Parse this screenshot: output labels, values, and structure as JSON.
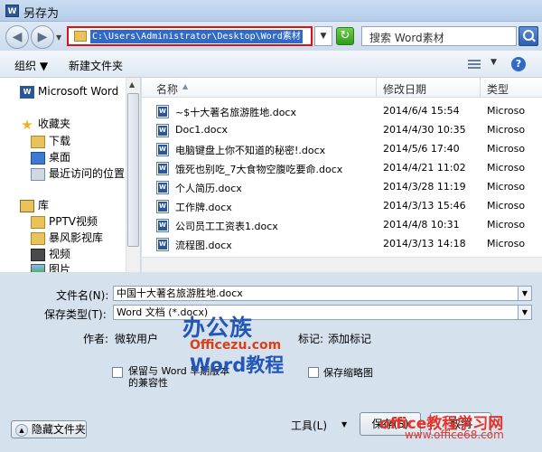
{
  "window": {
    "title": "另存为",
    "app_icon": "word-app-icon"
  },
  "nav": {
    "address": "C:\\Users\\Administrator\\Desktop\\Word素材",
    "search_placeholder": "搜索 Word素材"
  },
  "toolbar": {
    "organize": "组织 ▼",
    "new_folder": "新建文件夹",
    "help": "?"
  },
  "sidebar": {
    "items": [
      {
        "label": "Microsoft Word",
        "icon": "word-icon"
      },
      {
        "label": "收藏夹",
        "icon": "star-icon"
      },
      {
        "label": "下载",
        "icon": "folder-icon"
      },
      {
        "label": "桌面",
        "icon": "desktop-icon"
      },
      {
        "label": "最近访问的位置",
        "icon": "recent-icon"
      },
      {
        "label": "库",
        "icon": "library-icon"
      },
      {
        "label": "PPTV视频",
        "icon": "folder-icon"
      },
      {
        "label": "暴风影视库",
        "icon": "folder-icon"
      },
      {
        "label": "视频",
        "icon": "video-icon"
      },
      {
        "label": "图片",
        "icon": "picture-icon"
      }
    ]
  },
  "filelist": {
    "headers": {
      "name": "名称",
      "date": "修改日期",
      "type": "类型"
    },
    "files": [
      {
        "name": "~$十大著名旅游胜地.docx",
        "date": "2014/6/4 15:54",
        "type": "Microso"
      },
      {
        "name": "Doc1.docx",
        "date": "2014/4/30 10:35",
        "type": "Microso"
      },
      {
        "name": "电脑键盘上你不知道的秘密!.docx",
        "date": "2014/5/6 17:40",
        "type": "Microso"
      },
      {
        "name": "饿死也别吃_7大食物空腹吃要命.docx",
        "date": "2014/4/21 11:02",
        "type": "Microso"
      },
      {
        "name": "个人简历.docx",
        "date": "2014/3/28 11:19",
        "type": "Microso"
      },
      {
        "name": "工作牌.docx",
        "date": "2014/3/13 15:46",
        "type": "Microso"
      },
      {
        "name": "公司员工工资表1.docx",
        "date": "2014/4/8 10:31",
        "type": "Microso"
      },
      {
        "name": "流程图.docx",
        "date": "2014/3/13 14:18",
        "type": "Microso"
      }
    ]
  },
  "form": {
    "filename_label": "文件名(N):",
    "filename_value": "中国十大著名旅游胜地.docx",
    "filetype_label": "保存类型(T):",
    "filetype_value": "Word 文档 (*.docx)",
    "author_label": "作者:",
    "author_value": "微软用户",
    "tags_label": "标记:",
    "tags_value": "添加标记",
    "compat_checkbox": "保留与 Word 早期版本的兼容性",
    "thumbnail_checkbox": "保存缩略图"
  },
  "footer": {
    "hide_folders": "隐藏文件夹",
    "tools": "工具(L)",
    "save": "保存(S)",
    "cancel": "取消"
  },
  "watermarks": {
    "logo_line1": "办公族",
    "logo_line2": "Officezu.com",
    "logo_line3": "Word教程",
    "site_line1": "office教程学习网",
    "site_line2": "www.office68.com"
  },
  "colors": {
    "accent_red": "#e01010",
    "selection_blue": "#3169c6",
    "brand_blue": "#2257b8",
    "watermark_red": "#e3342c"
  }
}
